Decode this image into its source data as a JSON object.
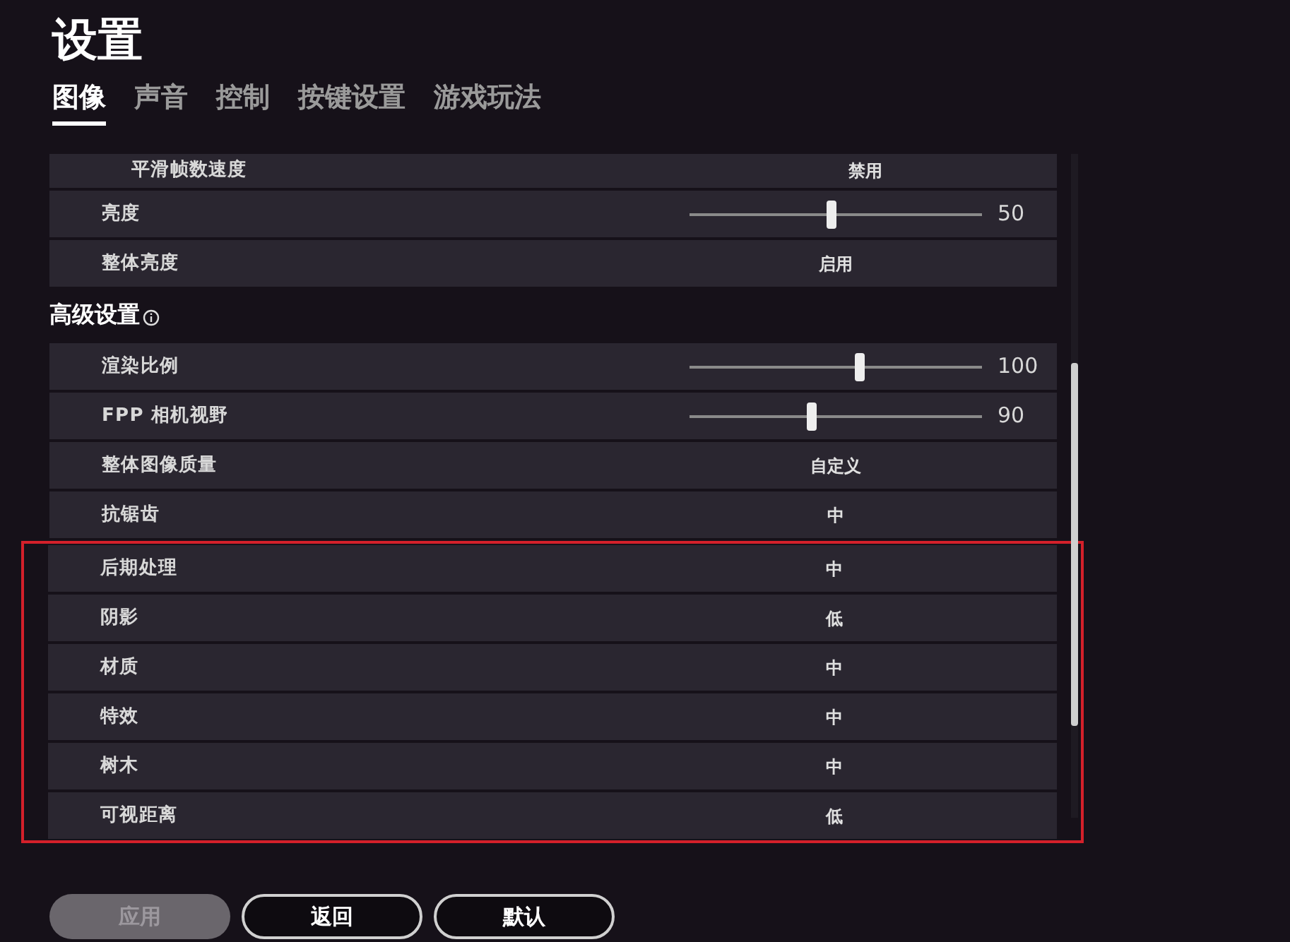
{
  "title": "设置",
  "tabs": [
    {
      "label": "图像",
      "selected": true
    },
    {
      "label": "声音",
      "selected": false
    },
    {
      "label": "控制",
      "selected": false
    },
    {
      "label": "按键设置",
      "selected": false
    },
    {
      "label": "游戏玩法",
      "selected": false
    }
  ],
  "rows": [
    {
      "kind": "value",
      "label": "平滑帧数速度",
      "value": "禁用"
    },
    {
      "kind": "slider",
      "label": "亮度",
      "level": 0.5,
      "value": "50"
    },
    {
      "kind": "value",
      "label": "整体亮度",
      "value": "启用"
    }
  ],
  "advanced": {
    "title": "高级设置",
    "rows": [
      {
        "kind": "slider",
        "label": "渲染比例",
        "level": 0.6,
        "value": "100"
      },
      {
        "kind": "slider",
        "label": "FPP 相机视野",
        "level": 0.43,
        "value": "90"
      },
      {
        "kind": "value",
        "label": "整体图像质量",
        "value": "自定义"
      },
      {
        "kind": "value",
        "label": "抗锯齿",
        "value": "中"
      }
    ],
    "highlighted_rows": [
      {
        "kind": "value",
        "label": "后期处理",
        "value": "中"
      },
      {
        "kind": "value",
        "label": "阴影",
        "value": "低"
      },
      {
        "kind": "value",
        "label": "材质",
        "value": "中"
      },
      {
        "kind": "value",
        "label": "特效",
        "value": "中"
      },
      {
        "kind": "value",
        "label": "树木",
        "value": "中"
      },
      {
        "kind": "value",
        "label": "可视距离",
        "value": "低"
      }
    ]
  },
  "buttons": [
    {
      "label": "应用",
      "disabled": true
    },
    {
      "label": "返回",
      "disabled": false
    },
    {
      "label": "默认",
      "disabled": false
    }
  ]
}
